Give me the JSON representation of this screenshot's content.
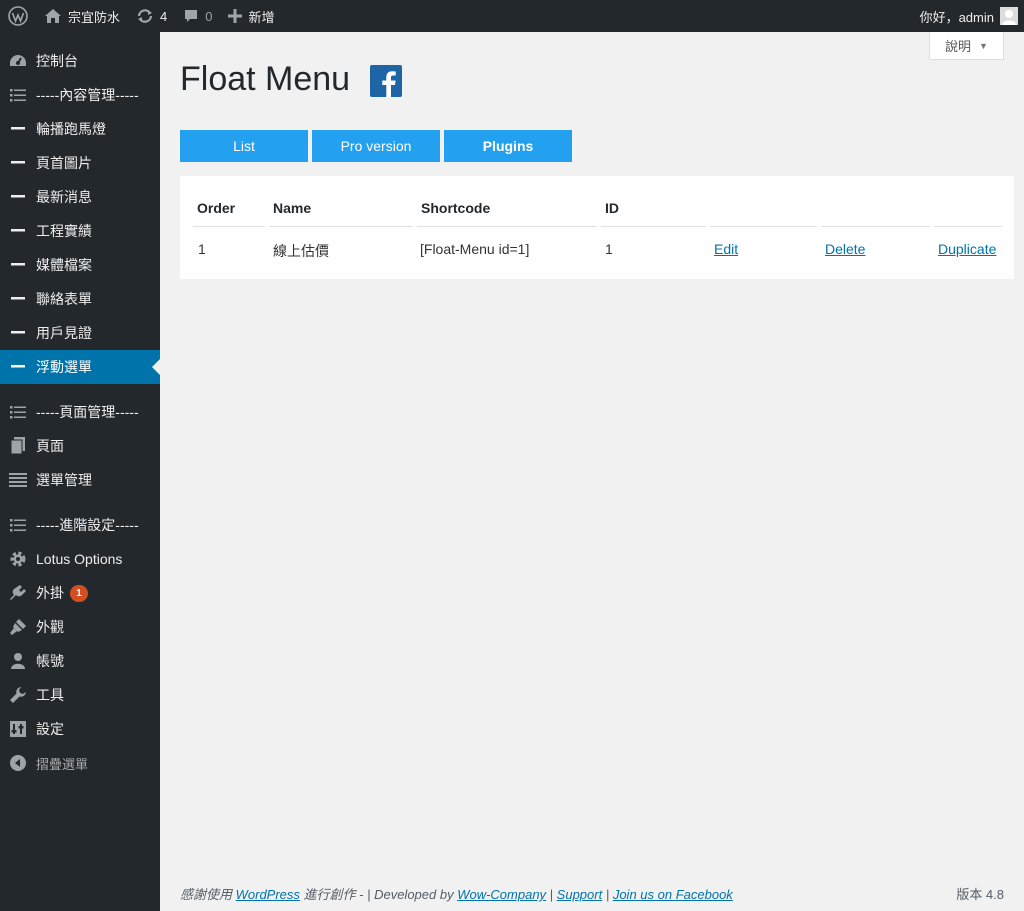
{
  "adminbar": {
    "site_name": "宗宜防水",
    "updates_count": "4",
    "comments_count": "0",
    "new_label": "新增",
    "greeting": "你好，admin"
  },
  "sidebar": {
    "items": [
      {
        "label": "控制台",
        "icon": "dashboard-icon"
      },
      {
        "label": "-----內容管理-----",
        "icon": "list-icon"
      },
      {
        "label": "輪播跑馬燈",
        "icon": "dash-icon"
      },
      {
        "label": "頁首圖片",
        "icon": "dash-icon"
      },
      {
        "label": "最新消息",
        "icon": "dash-icon"
      },
      {
        "label": "工程實績",
        "icon": "dash-icon"
      },
      {
        "label": "媒體檔案",
        "icon": "dash-icon"
      },
      {
        "label": "聯絡表單",
        "icon": "dash-icon"
      },
      {
        "label": "用戶見證",
        "icon": "dash-icon"
      },
      {
        "label": "浮動選單",
        "icon": "dash-icon"
      },
      {
        "label": "-----頁面管理-----",
        "icon": "list-icon"
      },
      {
        "label": "頁面",
        "icon": "pages-icon"
      },
      {
        "label": "選單管理",
        "icon": "menu-icon"
      },
      {
        "label": "-----進階設定-----",
        "icon": "list-icon"
      },
      {
        "label": "Lotus Options",
        "icon": "gear-icon"
      },
      {
        "label": "外掛",
        "icon": "plugin-icon",
        "badge": "1"
      },
      {
        "label": "外觀",
        "icon": "brush-icon"
      },
      {
        "label": "帳號",
        "icon": "user-icon"
      },
      {
        "label": "工具",
        "icon": "wrench-icon"
      },
      {
        "label": "設定",
        "icon": "settings-icon"
      },
      {
        "label": "摺疊選單",
        "icon": "collapse-icon"
      }
    ]
  },
  "help_tab": {
    "label": "說明"
  },
  "page": {
    "title": "Float Menu",
    "tabs": [
      "List",
      "Pro version",
      "Plugins"
    ]
  },
  "table": {
    "headers": [
      "Order",
      "Name",
      "Shortcode",
      "ID"
    ],
    "rows": [
      {
        "order": "1",
        "name": "線上估價",
        "shortcode": "[Float-Menu id=1]",
        "id": "1",
        "edit": "Edit",
        "delete": "Delete",
        "duplicate": "Duplicate"
      }
    ]
  },
  "footer": {
    "thanks_prefix": "感謝使用 ",
    "wordpress": "WordPress",
    "thanks_suffix": " 進行創作",
    "sep1": " - | Developed by ",
    "company": "Wow-Company",
    "sep2": " | ",
    "support": "Support",
    "sep3": " | ",
    "facebook": "Join us on Facebook",
    "version": "版本 4.8"
  },
  "colors": {
    "accent": "#0073aa",
    "button": "#23a0f0",
    "adminbar": "#23282d",
    "badge": "#d54e21"
  }
}
